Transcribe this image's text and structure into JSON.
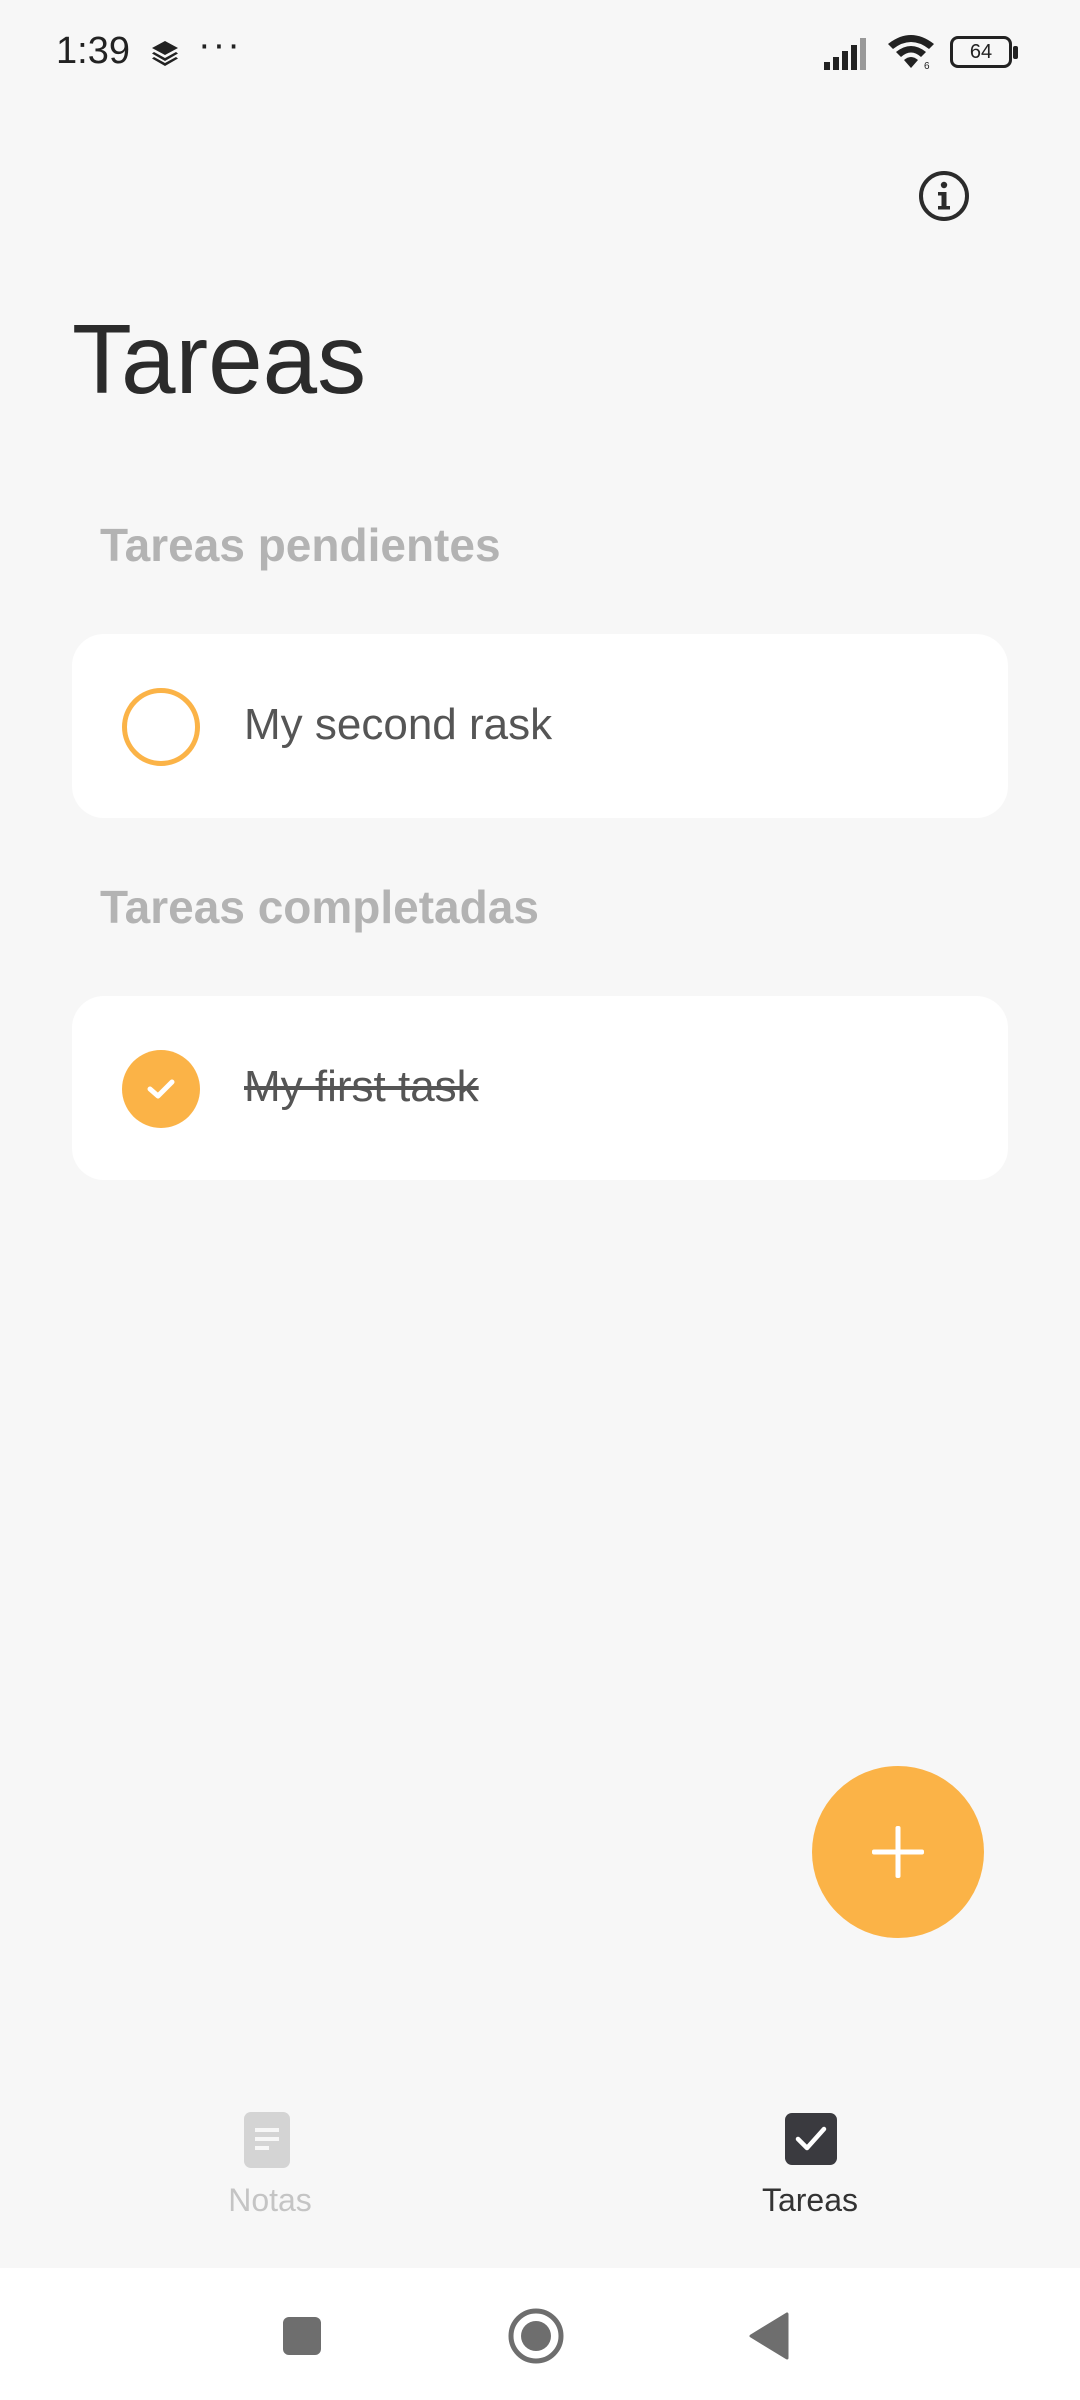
{
  "status_bar": {
    "time": "1:39",
    "dots": "···",
    "battery": "64"
  },
  "header": {
    "title": "Tareas",
    "info_icon": "info-icon"
  },
  "sections": {
    "pending_label": "Tareas pendientes",
    "completed_label": "Tareas completadas"
  },
  "tasks": {
    "pending": [
      {
        "text": "My second rask",
        "completed": false
      }
    ],
    "completed": [
      {
        "text": "My first task",
        "completed": true
      }
    ]
  },
  "fab": {
    "icon": "plus-icon"
  },
  "bottom_nav": {
    "items": [
      {
        "label": "Notas",
        "icon": "notes-icon",
        "active": false
      },
      {
        "label": "Tareas",
        "icon": "tasks-checkbox-icon",
        "active": true
      }
    ]
  },
  "system_nav": {
    "recent_icon": "square-recent-icon",
    "home_icon": "circle-home-icon",
    "back_icon": "triangle-back-icon"
  },
  "colors": {
    "accent": "#fbb347",
    "background": "#f7f7f7",
    "card": "#ffffff",
    "section_label": "#b3b3b3",
    "title": "#2b2b2b"
  }
}
